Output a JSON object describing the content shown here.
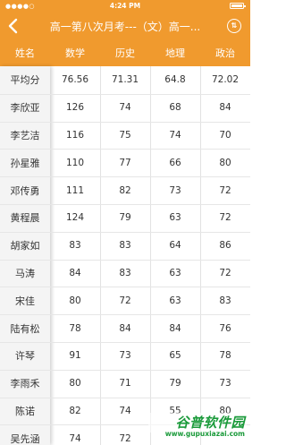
{
  "status_bar": {
    "signal": "●●●●○",
    "wifi": "WiFi",
    "time": "4:24 PM"
  },
  "nav": {
    "title": "高一第八次月考---（文）高一...",
    "back_icon": "chevron-left-icon",
    "action_icon": "sort-icon",
    "action_symbol": "⇅"
  },
  "table": {
    "headers": [
      "姓名",
      "数学",
      "历史",
      "地理",
      "政治"
    ],
    "rows": [
      [
        "平均分",
        "76.56",
        "71.31",
        "64.8",
        "72.02"
      ],
      [
        "李欣亚",
        "126",
        "74",
        "68",
        "84"
      ],
      [
        "李艺洁",
        "116",
        "75",
        "74",
        "70"
      ],
      [
        "孙星雅",
        "110",
        "77",
        "66",
        "80"
      ],
      [
        "邓传勇",
        "111",
        "82",
        "73",
        "72"
      ],
      [
        "黄程晨",
        "124",
        "79",
        "63",
        "72"
      ],
      [
        "胡家如",
        "83",
        "83",
        "64",
        "86"
      ],
      [
        "马涛",
        "84",
        "83",
        "63",
        "72"
      ],
      [
        "宋佳",
        "80",
        "72",
        "63",
        "83"
      ],
      [
        "陆有松",
        "78",
        "84",
        "84",
        "76"
      ],
      [
        "许琴",
        "91",
        "73",
        "65",
        "78"
      ],
      [
        "李雨禾",
        "80",
        "71",
        "79",
        "73"
      ],
      [
        "陈诺",
        "82",
        "74",
        "55",
        "80"
      ],
      [
        "吴先涵",
        "74",
        "72",
        "",
        ""
      ]
    ]
  },
  "watermark": {
    "text": "谷普软件园",
    "url": "www.gupuxiazai.com"
  },
  "colors": {
    "accent": "#f09a2e",
    "name_column": "#f4f4f4"
  }
}
